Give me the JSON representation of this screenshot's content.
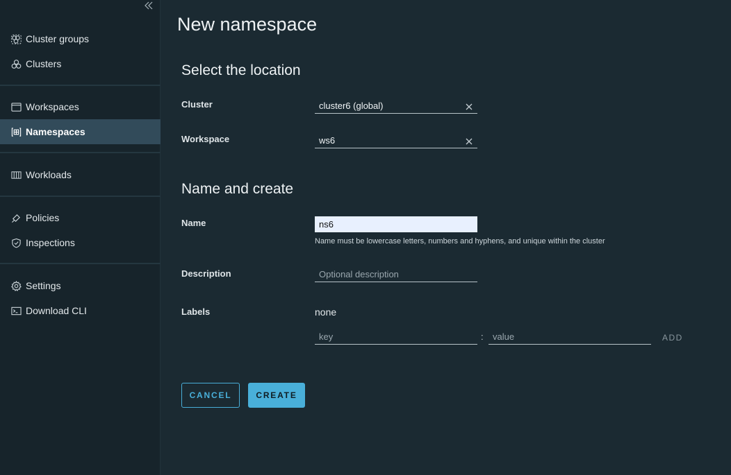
{
  "sidebar": {
    "items": [
      {
        "label": "Cluster groups",
        "icon": "cluster-groups-icon"
      },
      {
        "label": "Clusters",
        "icon": "clusters-icon"
      },
      {
        "label": "Workspaces",
        "icon": "workspaces-icon"
      },
      {
        "label": "Namespaces",
        "icon": "namespaces-icon",
        "active": true
      },
      {
        "label": "Workloads",
        "icon": "workloads-icon"
      },
      {
        "label": "Policies",
        "icon": "policies-icon"
      },
      {
        "label": "Inspections",
        "icon": "inspections-icon"
      },
      {
        "label": "Settings",
        "icon": "settings-icon"
      },
      {
        "label": "Download CLI",
        "icon": "terminal-icon"
      }
    ]
  },
  "main": {
    "title": "New namespace",
    "location": {
      "heading": "Select the location",
      "cluster_label": "Cluster",
      "cluster_value": "cluster6 (global)",
      "workspace_label": "Workspace",
      "workspace_value": "ws6"
    },
    "create": {
      "heading": "Name and create",
      "name_label": "Name",
      "name_value": "ns6",
      "name_hint": "Name must be lowercase letters, numbers and hyphens, and unique within the cluster",
      "description_label": "Description",
      "description_placeholder": "Optional description",
      "labels_label": "Labels",
      "labels_value": "none",
      "key_placeholder": "key",
      "separator": ":",
      "value_placeholder": "value",
      "add_label": "ADD"
    },
    "actions": {
      "cancel_label": "CANCEL",
      "create_label": "CREATE"
    }
  },
  "colors": {
    "accent": "#49afd9",
    "sidebar_bg": "#17242b",
    "main_bg": "#1b2a32",
    "active_item_bg": "#324b5a"
  }
}
